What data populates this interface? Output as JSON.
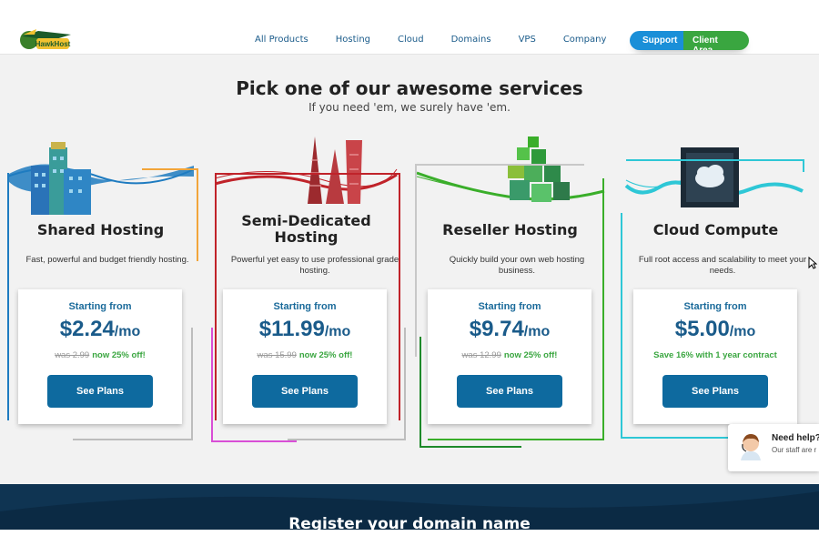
{
  "header": {
    "logo_text": "HawkHost",
    "nav": [
      "All Products",
      "Hosting",
      "Cloud",
      "Domains",
      "VPS",
      "Company"
    ],
    "support_label": "Support",
    "client_area_label": "Client Area"
  },
  "hero": {
    "title": "Pick one of our awesome services",
    "subtitle": "If you need 'em, we surely have 'em."
  },
  "cards": [
    {
      "name": "Shared Hosting",
      "description": "Fast, powerful and budget friendly hosting.",
      "starting_label": "Starting from",
      "price": "$2.24",
      "period": "/mo",
      "was": "was 2.99",
      "offer": "now 25% off!",
      "button": "See Plans",
      "accent": "#1e7bc0"
    },
    {
      "name": "Semi-Dedicated Hosting",
      "description": "Powerful yet easy to use professional grade hosting.",
      "starting_label": "Starting from",
      "price": "$11.99",
      "period": "/mo",
      "was": "was 15.99",
      "offer": "now 25% off!",
      "button": "See Plans",
      "accent": "#c0232a"
    },
    {
      "name": "Reseller Hosting",
      "description": "Quickly build your own web hosting business.",
      "starting_label": "Starting from",
      "price": "$9.74",
      "period": "/mo",
      "was": "was 12.99",
      "offer": "now 25% off!",
      "button": "See Plans",
      "accent": "#3aae2a"
    },
    {
      "name": "Cloud Compute",
      "description": "Full root access and scalability to meet your needs.",
      "starting_label": "Starting from",
      "price": "$5.00",
      "period": "/mo",
      "was": "",
      "offer": "Save 16% with 1 year contract",
      "button": "See Plans",
      "accent": "#2ec7d6"
    }
  ],
  "band": {
    "title": "Register your domain name"
  },
  "chat": {
    "title": "Need help?",
    "subtitle": "Our staff are r"
  }
}
